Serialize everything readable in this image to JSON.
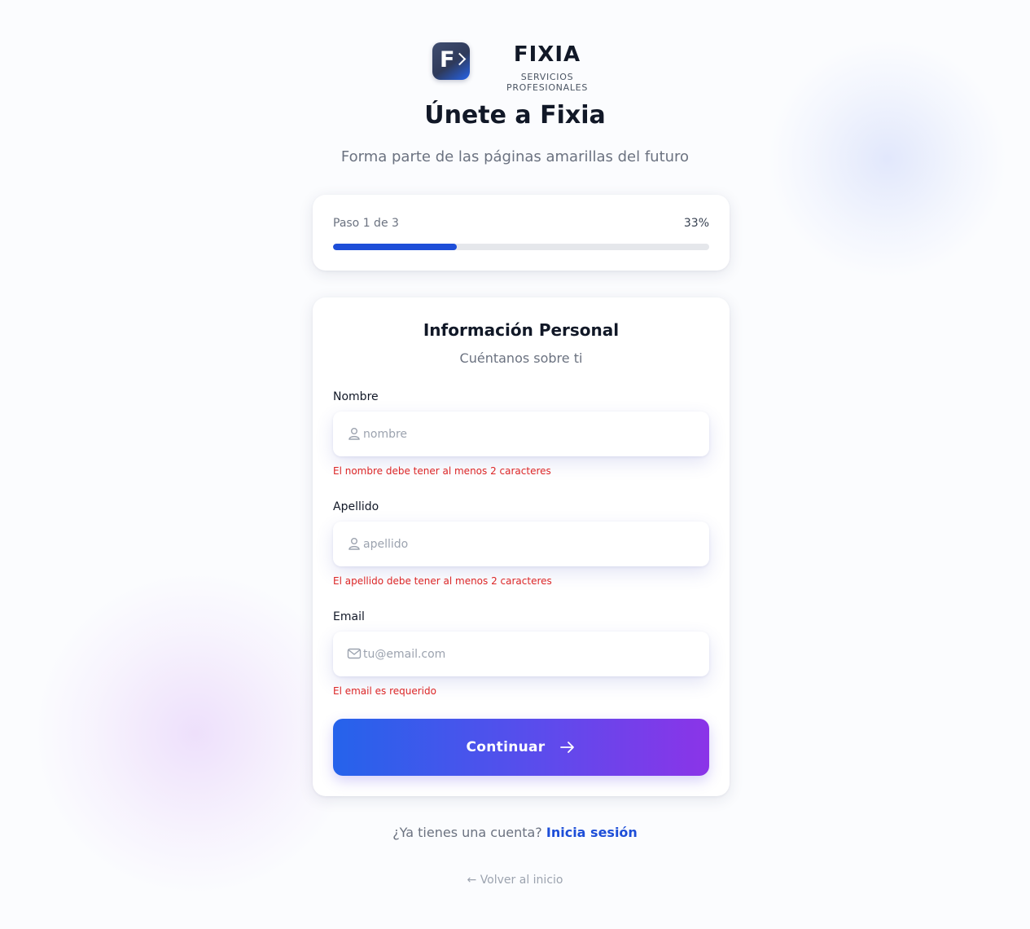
{
  "brand": {
    "name": "FIXIA",
    "tagline": "SERVICIOS PROFESIONALES",
    "logo_letter": "F"
  },
  "header": {
    "title": "Únete a Fixia",
    "subtitle": "Forma parte de las páginas amarillas del futuro"
  },
  "progress": {
    "step_label": "Paso 1 de 3",
    "percent_label": "33%",
    "percent": 33
  },
  "form": {
    "title": "Información Personal",
    "subtitle": "Cuéntanos sobre ti",
    "fields": [
      {
        "label": "Nombre",
        "placeholder": "nombre",
        "value": "",
        "icon": "user-icon",
        "error": "El nombre debe tener al menos 2 caracteres"
      },
      {
        "label": "Apellido",
        "placeholder": "apellido",
        "value": "",
        "icon": "user-icon",
        "error": "El apellido debe tener al menos 2 caracteres"
      },
      {
        "label": "Email",
        "placeholder": "tu@email.com",
        "value": "",
        "icon": "mail-icon",
        "error": "El email es requerido"
      }
    ],
    "submit_label": "Continuar",
    "submit_icon": "arrow-right-icon"
  },
  "footer": {
    "login_prompt": "¿Ya tienes una cuenta?",
    "login_link": "Inicia sesión",
    "back_link": "← Volver al inicio"
  },
  "colors": {
    "accent": "#1d4ed8",
    "error": "#dc2626",
    "button_gradient_start": "#2563eb",
    "button_gradient_end": "#8b34e8"
  }
}
